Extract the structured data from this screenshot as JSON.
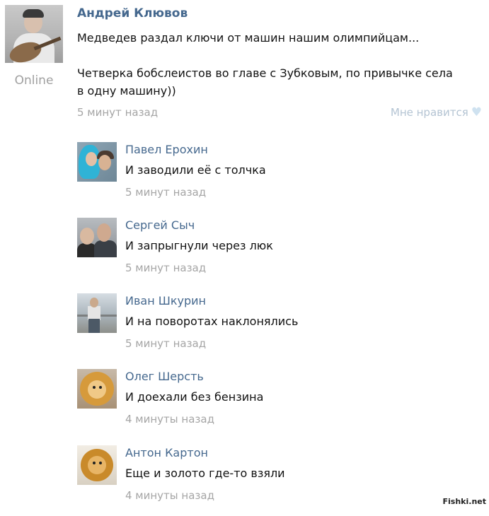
{
  "post": {
    "author": "Андрей Клювов",
    "status": "Online",
    "text": "Медведев раздал ключи от машин нашим олимпийцам...\n\nЧетверка бобслеистов во главе с Зубковым, по привычке села\nв одну машину))",
    "time": "5 минут назад",
    "like_label": "Мне нравится",
    "like_icon": "heart-icon"
  },
  "comments": [
    {
      "author": "Павел Ерохин",
      "text": "И заводили её с толчка",
      "time": "5 минут назад"
    },
    {
      "author": "Сергей Сыч",
      "text": "И запрыгнули через люк",
      "time": "5 минут назад"
    },
    {
      "author": "Иван Шкурин",
      "text": "И на поворотах наклонялись",
      "time": "5 минут назад"
    },
    {
      "author": "Олег Шерсть",
      "text": "И доехали без бензина",
      "time": "4 минуты назад"
    },
    {
      "author": "Антон Картон",
      "text": "Еще и золото где-то взяли",
      "time": "4 минуты назад"
    }
  ],
  "watermark": "Fishki.net",
  "colors": {
    "author_link": "#45688e",
    "time": "#a5a5a5",
    "like": "#b4c4d3"
  }
}
